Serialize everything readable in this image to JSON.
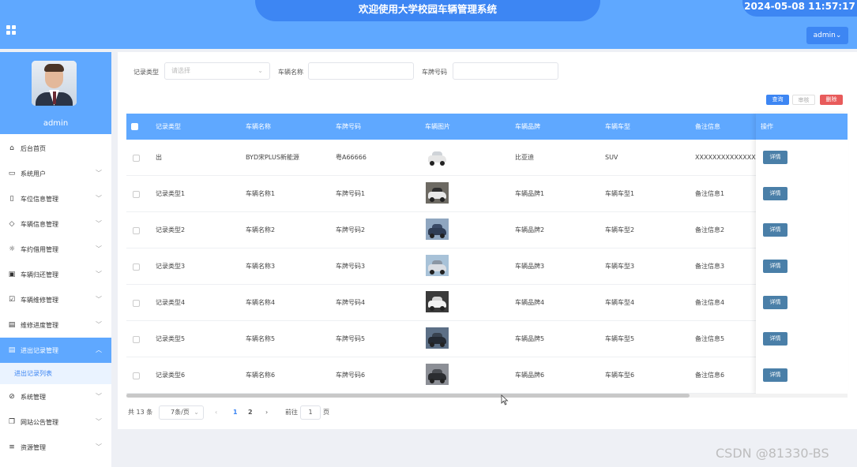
{
  "header": {
    "title": "欢迎使用大学校园车辆管理系统",
    "datetime": "2024-05-08 11:57:17",
    "user_button": "admin",
    "user_chevron": "⌄"
  },
  "sidebar": {
    "username": "admin",
    "items": [
      {
        "label": "后台首页",
        "icon": "home-icon",
        "glyph": "⌂",
        "chevron": false
      },
      {
        "label": "系统用户",
        "icon": "monitor-icon",
        "glyph": "▭",
        "chevron": true
      },
      {
        "label": "车位信息管理",
        "icon": "bookmark-icon",
        "glyph": "▯",
        "chevron": true
      },
      {
        "label": "车辆信息管理",
        "icon": "tag-icon",
        "glyph": "◇",
        "chevron": true
      },
      {
        "label": "车约借用管理",
        "icon": "sun-icon",
        "glyph": "☼",
        "chevron": true
      },
      {
        "label": "车辆归还管理",
        "icon": "inbox-icon",
        "glyph": "▣",
        "chevron": true
      },
      {
        "label": "车辆维修管理",
        "icon": "checklist-icon",
        "glyph": "☑",
        "chevron": true
      },
      {
        "label": "维修进度管理",
        "icon": "chat-icon",
        "glyph": "▤",
        "chevron": true
      },
      {
        "label": "进出记录管理",
        "icon": "list-icon",
        "glyph": "▤",
        "chevron": true,
        "active": true
      }
    ],
    "sub_item": "进出记录列表",
    "items_after": [
      {
        "label": "系统管理",
        "icon": "paperclip-icon",
        "glyph": "⊘",
        "chevron": true
      },
      {
        "label": "网站公告管理",
        "icon": "copy-icon",
        "glyph": "❐",
        "chevron": true
      },
      {
        "label": "资源管理",
        "icon": "sliders-icon",
        "glyph": "≡",
        "chevron": true
      }
    ]
  },
  "filters": {
    "record_type_label": "记录类型",
    "record_type_placeholder": "请选择",
    "vehicle_name_label": "车辆名称",
    "vehicle_name_value": "",
    "plate_label": "车牌号码",
    "plate_value": ""
  },
  "actions": {
    "query": "查询",
    "review": "审核",
    "delete": "删除"
  },
  "table": {
    "columns": [
      "记录类型",
      "车辆名称",
      "车牌号码",
      "车辆图片",
      "车辆品牌",
      "车辆车型",
      "备注信息",
      "操作"
    ],
    "rows": [
      {
        "type": "出",
        "name": "BYD宋PLUS新能源",
        "plate": "粤A66666",
        "brand": "比亚迪",
        "model": "SUV",
        "note": "XXXXXXXXXXXXXX",
        "img": "white-suv"
      },
      {
        "type": "记录类型1",
        "name": "车辆名称1",
        "plate": "车牌号码1",
        "brand": "车辆品牌1",
        "model": "车辆车型1",
        "note": "备注信息1",
        "img": "dark-suv"
      },
      {
        "type": "记录类型2",
        "name": "车辆名称2",
        "plate": "车牌号码2",
        "brand": "车辆品牌2",
        "model": "车辆车型2",
        "note": "备注信息2",
        "img": "blue-sedan"
      },
      {
        "type": "记录类型3",
        "name": "车辆名称3",
        "plate": "车牌号码3",
        "brand": "车辆品牌3",
        "model": "车辆车型3",
        "note": "备注信息3",
        "img": "parking-lot"
      },
      {
        "type": "记录类型4",
        "name": "车辆名称4",
        "plate": "车牌号码4",
        "brand": "车辆品牌4",
        "model": "车辆车型4",
        "note": "备注信息4",
        "img": "white-suv-dark"
      },
      {
        "type": "记录类型5",
        "name": "车辆名称5",
        "plate": "车牌号码5",
        "brand": "车辆品牌5",
        "model": "车辆车型5",
        "note": "备注信息5",
        "img": "road-sunset"
      },
      {
        "type": "记录类型6",
        "name": "车辆名称6",
        "plate": "车牌号码6",
        "brand": "车辆品牌6",
        "model": "车辆车型6",
        "note": "备注信息6",
        "img": "dark-sedan"
      }
    ],
    "detail_label": "详情"
  },
  "pagination": {
    "total": "共 13 条",
    "page_size": "7条/页",
    "prev": "‹",
    "pages": [
      "1",
      "2"
    ],
    "current_page": "1",
    "next": "›",
    "goto_label": "前往",
    "goto_value": "1",
    "goto_suffix": "页"
  },
  "watermark": "CSDN @81330-BS",
  "colors": {
    "primary": "#5fa8ff",
    "primary_dark": "#3d86f3",
    "detail_button": "#4a7fa8",
    "delete_button": "#e85b5b"
  }
}
